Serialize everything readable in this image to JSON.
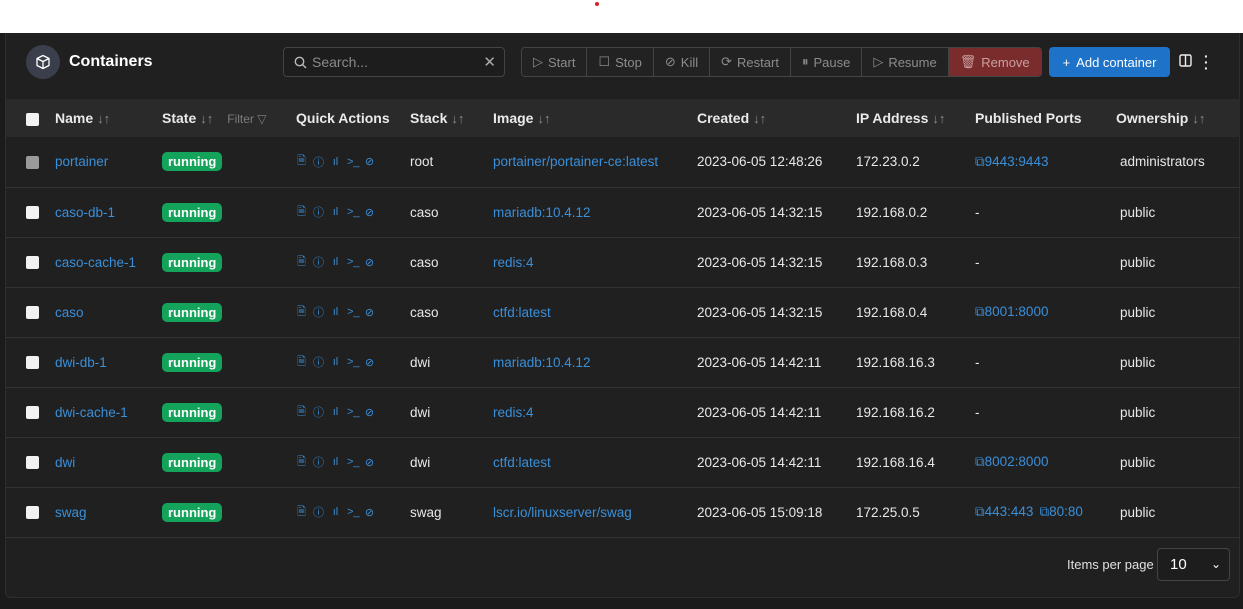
{
  "header": {
    "title": "Containers",
    "search_placeholder": "Search...",
    "actions": [
      "Start",
      "Stop",
      "Kill",
      "Restart",
      "Pause",
      "Resume",
      "Remove"
    ],
    "add_label": "Add container"
  },
  "columns": {
    "name": "Name",
    "state": "State",
    "filter": "Filter",
    "quick_actions": "Quick Actions",
    "stack": "Stack",
    "image": "Image",
    "created": "Created",
    "ip": "IP Address",
    "ports": "Published Ports",
    "ownership": "Ownership"
  },
  "rows": [
    {
      "name": "portainer",
      "state": "running",
      "stack": "root",
      "image": "portainer/portainer-ce:latest",
      "created": "2023-06-05 12:48:26",
      "ip": "172.23.0.2",
      "ports": [
        "9443:9443"
      ],
      "ownership": "administrators"
    },
    {
      "name": "caso-db-1",
      "state": "running",
      "stack": "caso",
      "image": "mariadb:10.4.12",
      "created": "2023-06-05 14:32:15",
      "ip": "192.168.0.2",
      "ports": [],
      "ownership": "public"
    },
    {
      "name": "caso-cache-1",
      "state": "running",
      "stack": "caso",
      "image": "redis:4",
      "created": "2023-06-05 14:32:15",
      "ip": "192.168.0.3",
      "ports": [],
      "ownership": "public"
    },
    {
      "name": "caso",
      "state": "running",
      "stack": "caso",
      "image": "ctfd:latest",
      "created": "2023-06-05 14:32:15",
      "ip": "192.168.0.4",
      "ports": [
        "8001:8000"
      ],
      "ownership": "public"
    },
    {
      "name": "dwi-db-1",
      "state": "running",
      "stack": "dwi",
      "image": "mariadb:10.4.12",
      "created": "2023-06-05 14:42:11",
      "ip": "192.168.16.3",
      "ports": [],
      "ownership": "public"
    },
    {
      "name": "dwi-cache-1",
      "state": "running",
      "stack": "dwi",
      "image": "redis:4",
      "created": "2023-06-05 14:42:11",
      "ip": "192.168.16.2",
      "ports": [],
      "ownership": "public"
    },
    {
      "name": "dwi",
      "state": "running",
      "stack": "dwi",
      "image": "ctfd:latest",
      "created": "2023-06-05 14:42:11",
      "ip": "192.168.16.4",
      "ports": [
        "8002:8000"
      ],
      "ownership": "public"
    },
    {
      "name": "swag",
      "state": "running",
      "stack": "swag",
      "image": "lscr.io/linuxserver/swag",
      "created": "2023-06-05 15:09:18",
      "ip": "172.25.0.5",
      "ports": [
        "443:443",
        "80:80"
      ],
      "ownership": "public"
    }
  ],
  "no_port_text": "-",
  "footer": {
    "items_per_page_label": "Items per page",
    "items_per_page_value": "10"
  },
  "colors": {
    "accent": "#1e72c8",
    "link": "#3a8fd9",
    "running": "#14a35a",
    "remove": "#7a2b2b"
  }
}
